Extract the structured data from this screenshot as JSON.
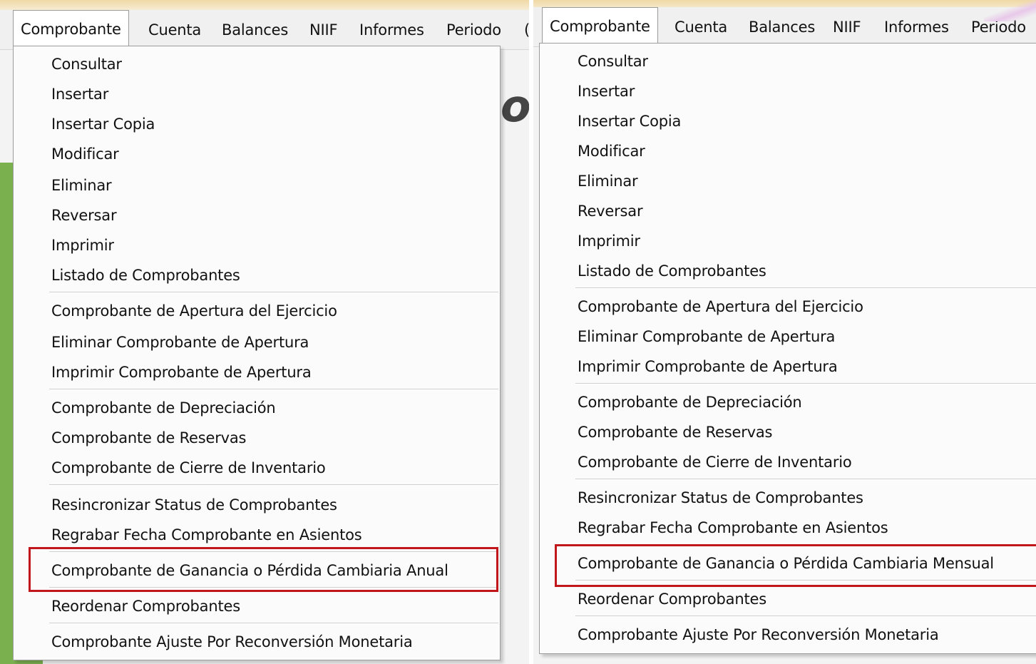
{
  "left": {
    "menubar": [
      "Comprobante",
      "Cuenta",
      "Balances",
      "NIIF",
      "Informes",
      "Periodo"
    ],
    "partial": "(",
    "items": [
      "Consultar",
      "Insertar",
      "Insertar Copia",
      "Modificar",
      "Eliminar",
      "Reversar",
      "Imprimir",
      "Listado de Comprobantes",
      "Comprobante de Apertura del Ejercicio",
      "Eliminar Comprobante de Apertura",
      "Imprimir Comprobante de Apertura",
      "Comprobante de Depreciación",
      "Comprobante de Reservas",
      "Comprobante de Cierre de Inventario",
      "Resincronizar Status de Comprobantes",
      "Regrabar Fecha Comprobante en Asientos",
      "Comprobante de Ganancia o Pérdida Cambiaria Anual",
      "Reordenar Comprobantes",
      "Comprobante Ajuste Por Reconversión Monetaria"
    ],
    "bg_glyph": "o"
  },
  "right": {
    "menubar": [
      "Comprobante",
      "Cuenta",
      "Balances",
      "NIIF",
      "Informes",
      "Periodo"
    ],
    "items": [
      "Consultar",
      "Insertar",
      "Insertar Copia",
      "Modificar",
      "Eliminar",
      "Reversar",
      "Imprimir",
      "Listado de Comprobantes",
      "Comprobante de Apertura del Ejercicio",
      "Eliminar Comprobante de Apertura",
      "Imprimir Comprobante de Apertura",
      "Comprobante de Depreciación",
      "Comprobante de Reservas",
      "Comprobante de Cierre de Inventario",
      "Resincronizar Status de Comprobantes",
      "Regrabar Fecha Comprobante en Asientos",
      "Comprobante de Ganancia o Pérdida Cambiaria Mensual",
      "Reordenar Comprobantes",
      "Comprobante Ajuste Por Reconversión Monetaria"
    ]
  },
  "colors": {
    "highlight": "#c0161c",
    "menu_bg": "#fbfbfb",
    "side_green": "#7bb04f"
  }
}
